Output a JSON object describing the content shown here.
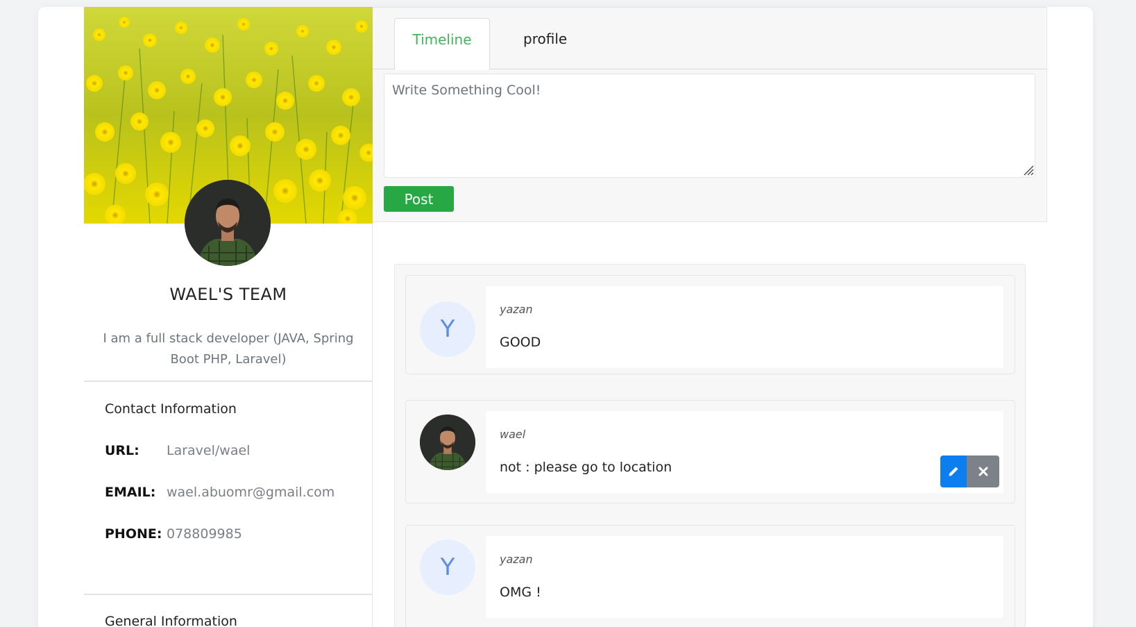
{
  "profile": {
    "name": "WAEL'S TEAM",
    "bio": "I am a full stack developer (JAVA, Spring Boot PHP, Laravel)",
    "contact": {
      "title": "Contact Information",
      "rows": [
        {
          "key": "URL:",
          "value": "Laravel/wael"
        },
        {
          "key": "EMAIL:",
          "value": "wael.abuomr@gmail.com"
        },
        {
          "key": "PHONE:",
          "value": "078809985"
        }
      ]
    },
    "general_title": "General Information"
  },
  "tabs": [
    {
      "label": "Timeline",
      "active": true
    },
    {
      "label": "profile",
      "active": false
    }
  ],
  "composer": {
    "placeholder": "Write Something Cool!",
    "post_label": "Post"
  },
  "posts": [
    {
      "author": "yazan",
      "text": "GOOD",
      "avatar_letter": "Y",
      "avatar_type": "letter"
    },
    {
      "author": "wael",
      "text": "not : please go to location",
      "avatar_type": "photo"
    },
    {
      "author": "yazan",
      "text": "OMG !",
      "avatar_letter": "Y",
      "avatar_type": "letter"
    }
  ],
  "icons": {
    "edit": "pencil-icon",
    "delete": "close-icon"
  },
  "colors": {
    "accent_tab": "#3fb65a",
    "post_button": "#28a745",
    "edit_button": "#0d7ef0",
    "delete_button": "#7c8287",
    "letter_avatar_bg": "#e7effe",
    "letter_avatar_fg": "#5b8de8"
  }
}
